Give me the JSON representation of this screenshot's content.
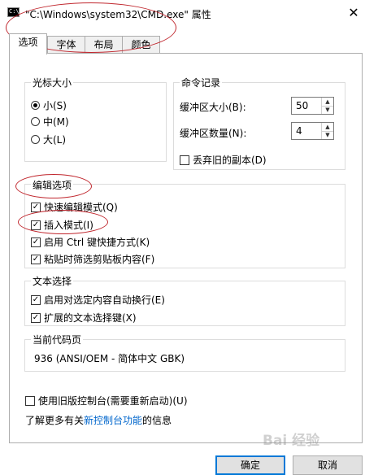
{
  "window": {
    "title": "\"C:\\Windows\\system32\\CMD.exe\" 属性",
    "app_icon_text": "C:\\",
    "close_glyph": "✕"
  },
  "tabs": [
    {
      "label": "选项",
      "selected": true
    },
    {
      "label": "字体",
      "selected": false
    },
    {
      "label": "布局",
      "selected": false
    },
    {
      "label": "颜色",
      "selected": false
    }
  ],
  "cursor_size": {
    "title": "光标大小",
    "options": [
      {
        "label": "小(S)",
        "selected": true
      },
      {
        "label": "中(M)",
        "selected": false
      },
      {
        "label": "大(L)",
        "selected": false
      }
    ]
  },
  "command_history": {
    "title": "命令记录",
    "buffer_size_label": "缓冲区大小(B):",
    "buffer_size_value": "50",
    "buffer_count_label": "缓冲区数量(N):",
    "buffer_count_value": "4",
    "discard_duplicates_label": "丢弃旧的副本(D)",
    "discard_duplicates_checked": false
  },
  "edit_options": {
    "title": "编辑选项",
    "items": [
      {
        "label": "快速编辑模式(Q)",
        "checked": true
      },
      {
        "label": "插入模式(I)",
        "checked": true
      },
      {
        "label": "启用 Ctrl 键快捷方式(K)",
        "checked": true
      },
      {
        "label": "粘贴时筛选剪贴板内容(F)",
        "checked": true
      }
    ]
  },
  "text_selection": {
    "title": "文本选择",
    "items": [
      {
        "label": "启用对选定内容自动换行(E)",
        "checked": true
      },
      {
        "label": "扩展的文本选择键(X)",
        "checked": true
      }
    ]
  },
  "code_page": {
    "title": "当前代码页",
    "value": "936   (ANSI/OEM - 简体中文 GBK)"
  },
  "legacy_console": {
    "label": "使用旧版控制台(需要重新启动)(U)",
    "checked": false
  },
  "learn_more": {
    "prefix": "了解更多有关",
    "link": "新控制台功能",
    "suffix": "的信息"
  },
  "buttons": {
    "ok": "确定",
    "cancel": "取消"
  },
  "colors": {
    "annotation_red": "#c0262d",
    "link_blue": "#0066cc",
    "default_button_border": "#0078d7"
  },
  "watermark": "Bai 经验"
}
